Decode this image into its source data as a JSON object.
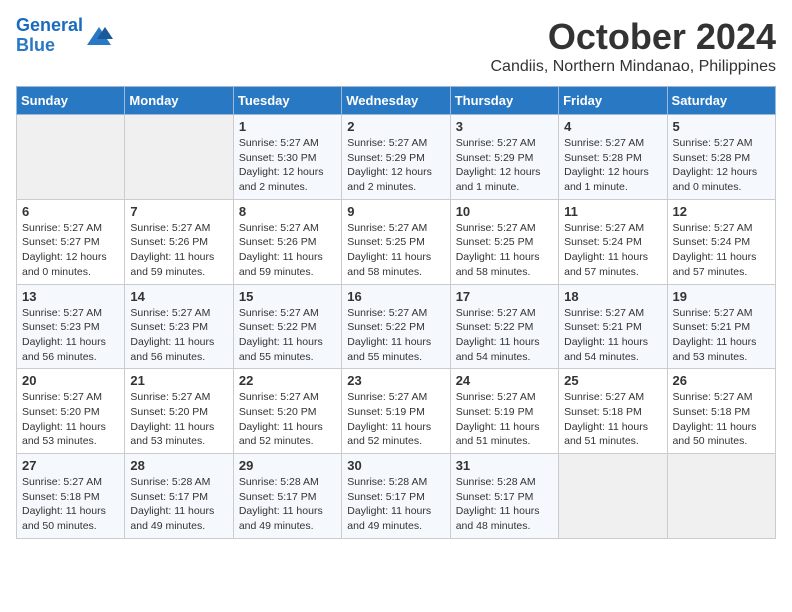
{
  "header": {
    "logo_line1": "General",
    "logo_line2": "Blue",
    "month": "October 2024",
    "location": "Candiis, Northern Mindanao, Philippines"
  },
  "weekdays": [
    "Sunday",
    "Monday",
    "Tuesday",
    "Wednesday",
    "Thursday",
    "Friday",
    "Saturday"
  ],
  "weeks": [
    [
      {
        "day": "",
        "info": ""
      },
      {
        "day": "",
        "info": ""
      },
      {
        "day": "1",
        "info": "Sunrise: 5:27 AM\nSunset: 5:30 PM\nDaylight: 12 hours\nand 2 minutes."
      },
      {
        "day": "2",
        "info": "Sunrise: 5:27 AM\nSunset: 5:29 PM\nDaylight: 12 hours\nand 2 minutes."
      },
      {
        "day": "3",
        "info": "Sunrise: 5:27 AM\nSunset: 5:29 PM\nDaylight: 12 hours\nand 1 minute."
      },
      {
        "day": "4",
        "info": "Sunrise: 5:27 AM\nSunset: 5:28 PM\nDaylight: 12 hours\nand 1 minute."
      },
      {
        "day": "5",
        "info": "Sunrise: 5:27 AM\nSunset: 5:28 PM\nDaylight: 12 hours\nand 0 minutes."
      }
    ],
    [
      {
        "day": "6",
        "info": "Sunrise: 5:27 AM\nSunset: 5:27 PM\nDaylight: 12 hours\nand 0 minutes."
      },
      {
        "day": "7",
        "info": "Sunrise: 5:27 AM\nSunset: 5:26 PM\nDaylight: 11 hours\nand 59 minutes."
      },
      {
        "day": "8",
        "info": "Sunrise: 5:27 AM\nSunset: 5:26 PM\nDaylight: 11 hours\nand 59 minutes."
      },
      {
        "day": "9",
        "info": "Sunrise: 5:27 AM\nSunset: 5:25 PM\nDaylight: 11 hours\nand 58 minutes."
      },
      {
        "day": "10",
        "info": "Sunrise: 5:27 AM\nSunset: 5:25 PM\nDaylight: 11 hours\nand 58 minutes."
      },
      {
        "day": "11",
        "info": "Sunrise: 5:27 AM\nSunset: 5:24 PM\nDaylight: 11 hours\nand 57 minutes."
      },
      {
        "day": "12",
        "info": "Sunrise: 5:27 AM\nSunset: 5:24 PM\nDaylight: 11 hours\nand 57 minutes."
      }
    ],
    [
      {
        "day": "13",
        "info": "Sunrise: 5:27 AM\nSunset: 5:23 PM\nDaylight: 11 hours\nand 56 minutes."
      },
      {
        "day": "14",
        "info": "Sunrise: 5:27 AM\nSunset: 5:23 PM\nDaylight: 11 hours\nand 56 minutes."
      },
      {
        "day": "15",
        "info": "Sunrise: 5:27 AM\nSunset: 5:22 PM\nDaylight: 11 hours\nand 55 minutes."
      },
      {
        "day": "16",
        "info": "Sunrise: 5:27 AM\nSunset: 5:22 PM\nDaylight: 11 hours\nand 55 minutes."
      },
      {
        "day": "17",
        "info": "Sunrise: 5:27 AM\nSunset: 5:22 PM\nDaylight: 11 hours\nand 54 minutes."
      },
      {
        "day": "18",
        "info": "Sunrise: 5:27 AM\nSunset: 5:21 PM\nDaylight: 11 hours\nand 54 minutes."
      },
      {
        "day": "19",
        "info": "Sunrise: 5:27 AM\nSunset: 5:21 PM\nDaylight: 11 hours\nand 53 minutes."
      }
    ],
    [
      {
        "day": "20",
        "info": "Sunrise: 5:27 AM\nSunset: 5:20 PM\nDaylight: 11 hours\nand 53 minutes."
      },
      {
        "day": "21",
        "info": "Sunrise: 5:27 AM\nSunset: 5:20 PM\nDaylight: 11 hours\nand 53 minutes."
      },
      {
        "day": "22",
        "info": "Sunrise: 5:27 AM\nSunset: 5:20 PM\nDaylight: 11 hours\nand 52 minutes."
      },
      {
        "day": "23",
        "info": "Sunrise: 5:27 AM\nSunset: 5:19 PM\nDaylight: 11 hours\nand 52 minutes."
      },
      {
        "day": "24",
        "info": "Sunrise: 5:27 AM\nSunset: 5:19 PM\nDaylight: 11 hours\nand 51 minutes."
      },
      {
        "day": "25",
        "info": "Sunrise: 5:27 AM\nSunset: 5:18 PM\nDaylight: 11 hours\nand 51 minutes."
      },
      {
        "day": "26",
        "info": "Sunrise: 5:27 AM\nSunset: 5:18 PM\nDaylight: 11 hours\nand 50 minutes."
      }
    ],
    [
      {
        "day": "27",
        "info": "Sunrise: 5:27 AM\nSunset: 5:18 PM\nDaylight: 11 hours\nand 50 minutes."
      },
      {
        "day": "28",
        "info": "Sunrise: 5:28 AM\nSunset: 5:17 PM\nDaylight: 11 hours\nand 49 minutes."
      },
      {
        "day": "29",
        "info": "Sunrise: 5:28 AM\nSunset: 5:17 PM\nDaylight: 11 hours\nand 49 minutes."
      },
      {
        "day": "30",
        "info": "Sunrise: 5:28 AM\nSunset: 5:17 PM\nDaylight: 11 hours\nand 49 minutes."
      },
      {
        "day": "31",
        "info": "Sunrise: 5:28 AM\nSunset: 5:17 PM\nDaylight: 11 hours\nand 48 minutes."
      },
      {
        "day": "",
        "info": ""
      },
      {
        "day": "",
        "info": ""
      }
    ]
  ]
}
